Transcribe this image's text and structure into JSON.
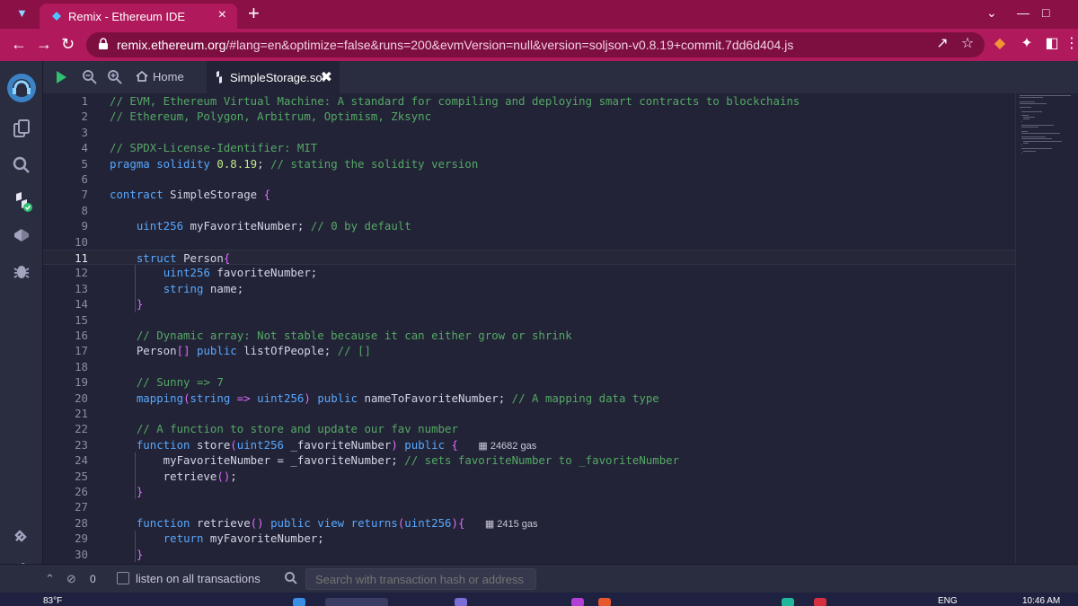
{
  "browser": {
    "tab_title": "Remix - Ethereum IDE",
    "url_host": "remix.ethereum.org",
    "url_path": "/#lang=en&optimize=false&runs=200&evmVersion=null&version=soljson-v0.8.19+commit.7dd6d404.js"
  },
  "toolbar": {
    "home_label": "Home",
    "file_tab_label": "SimpleStorage.sol"
  },
  "editor": {
    "active_line": 11,
    "lines": [
      {
        "n": "1",
        "html": "<span class=\"c-cm\">// EVM, Ethereum Virtual Machine: A standard for compiling and deploying smart contracts to blockchains</span>"
      },
      {
        "n": "2",
        "html": "<span class=\"c-cm\">// Ethereum, Polygon, Arbitrum, Optimism, Zksync</span>"
      },
      {
        "n": "3",
        "html": ""
      },
      {
        "n": "4",
        "html": "<span class=\"c-cm\">// SPDX-License-Identifier: MIT</span>"
      },
      {
        "n": "5",
        "html": "<span class=\"c-kw\">pragma solidity</span> <span class=\"c-num\">0.8.19</span>; <span class=\"c-cm\">// stating the solidity version</span>"
      },
      {
        "n": "6",
        "html": ""
      },
      {
        "n": "7",
        "html": "<span class=\"c-kw\">contract</span> SimpleStorage <span class=\"c-br\">{</span>"
      },
      {
        "n": "8",
        "html": ""
      },
      {
        "n": "9",
        "html": "    <span class=\"c-ty\">uint256</span> myFavoriteNumber; <span class=\"c-cm\">// 0 by default</span>"
      },
      {
        "n": "10",
        "html": ""
      },
      {
        "n": "11",
        "html": "    <span class=\"c-kw\">struct</span> Person<span class=\"c-br\">{</span>"
      },
      {
        "n": "12",
        "html": "        <span class=\"c-ty\">uint256</span> favoriteNumber;"
      },
      {
        "n": "13",
        "html": "        <span class=\"c-ty\">string</span> name;"
      },
      {
        "n": "14",
        "html": "    <span class=\"c-br\">}</span>"
      },
      {
        "n": "15",
        "html": ""
      },
      {
        "n": "16",
        "html": "    <span class=\"c-cm\">// Dynamic array: Not stable because it can either grow or shrink</span>"
      },
      {
        "n": "17",
        "html": "    Person<span class=\"c-br\">[]</span> <span class=\"c-kw\">public</span> listOfPeople; <span class=\"c-cm\">// []</span>"
      },
      {
        "n": "18",
        "html": ""
      },
      {
        "n": "19",
        "html": "    <span class=\"c-cm\">// Sunny =&gt; 7</span>"
      },
      {
        "n": "20",
        "html": "    <span class=\"c-kw\">mapping</span><span class=\"c-br\">(</span><span class=\"c-ty\">string</span> <span class=\"c-br\">=&gt;</span> <span class=\"c-ty\">uint256</span><span class=\"c-br\">)</span> <span class=\"c-kw\">public</span> nameToFavoriteNumber; <span class=\"c-cm\">// A mapping data type</span>"
      },
      {
        "n": "21",
        "html": ""
      },
      {
        "n": "22",
        "html": "    <span class=\"c-cm\">// A function to store and update our fav number</span>"
      },
      {
        "n": "23",
        "html": "    <span class=\"c-kw\">function</span> store<span class=\"c-br\">(</span><span class=\"c-ty\">uint256</span> _favoriteNumber<span class=\"c-br\">)</span> <span class=\"c-kw\">public</span> <span class=\"c-br\">{</span>   <span class=\"gas\">&#9638; 24682 gas</span>"
      },
      {
        "n": "24",
        "html": "        myFavoriteNumber = _favoriteNumber; <span class=\"c-cm\">// sets favoriteNumber to _favoriteNumber</span>"
      },
      {
        "n": "25",
        "html": "        retrieve<span class=\"c-br\">()</span>;"
      },
      {
        "n": "26",
        "html": "    <span class=\"c-br\">}</span>"
      },
      {
        "n": "27",
        "html": ""
      },
      {
        "n": "28",
        "html": "    <span class=\"c-kw\">function</span> retrieve<span class=\"c-br\">()</span> <span class=\"c-kw\">public</span> <span class=\"c-kw\">view</span> <span class=\"c-kw\">returns</span><span class=\"c-br\">(</span><span class=\"c-ty\">uint256</span><span class=\"c-br\">){</span>   <span class=\"gas\">&#9638; 2415 gas</span>"
      },
      {
        "n": "29",
        "html": "        <span class=\"c-kw\">return</span> myFavoriteNumber;"
      },
      {
        "n": "30",
        "html": "    <span class=\"c-br\">}</span>"
      }
    ]
  },
  "terminal": {
    "count": "0",
    "listen_label": "listen on all transactions",
    "search_placeholder": "Search with transaction hash or address"
  },
  "taskbar": {
    "weather": "83°F",
    "lang": "ENG",
    "time": "10:46 AM"
  },
  "colors": {
    "chrome_tabbar": "#8a1046",
    "chrome_address": "#b0195c",
    "remix_bg": "#222336",
    "remix_panel": "#2a2c3f"
  }
}
